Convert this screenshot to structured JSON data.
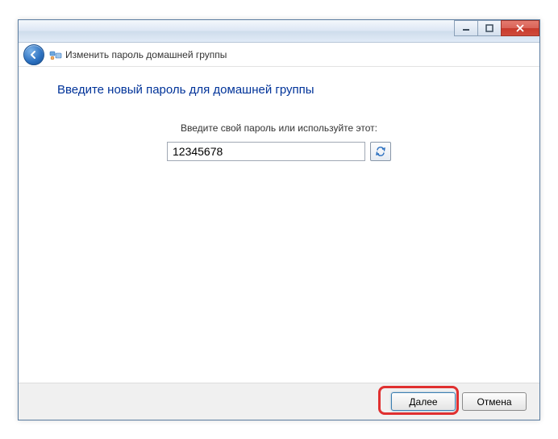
{
  "window": {
    "breadcrumb": "Изменить пароль домашней группы"
  },
  "content": {
    "heading": "Введите новый пароль для домашней группы",
    "prompt": "Введите свой пароль или используйте этот:",
    "password_value": "12345678"
  },
  "buttons": {
    "next": "Далее",
    "cancel": "Отмена"
  },
  "icons": {
    "back": "back-arrow",
    "homegroup": "homegroup",
    "refresh": "refresh",
    "minimize": "minimize",
    "maximize": "maximize",
    "close": "close"
  }
}
